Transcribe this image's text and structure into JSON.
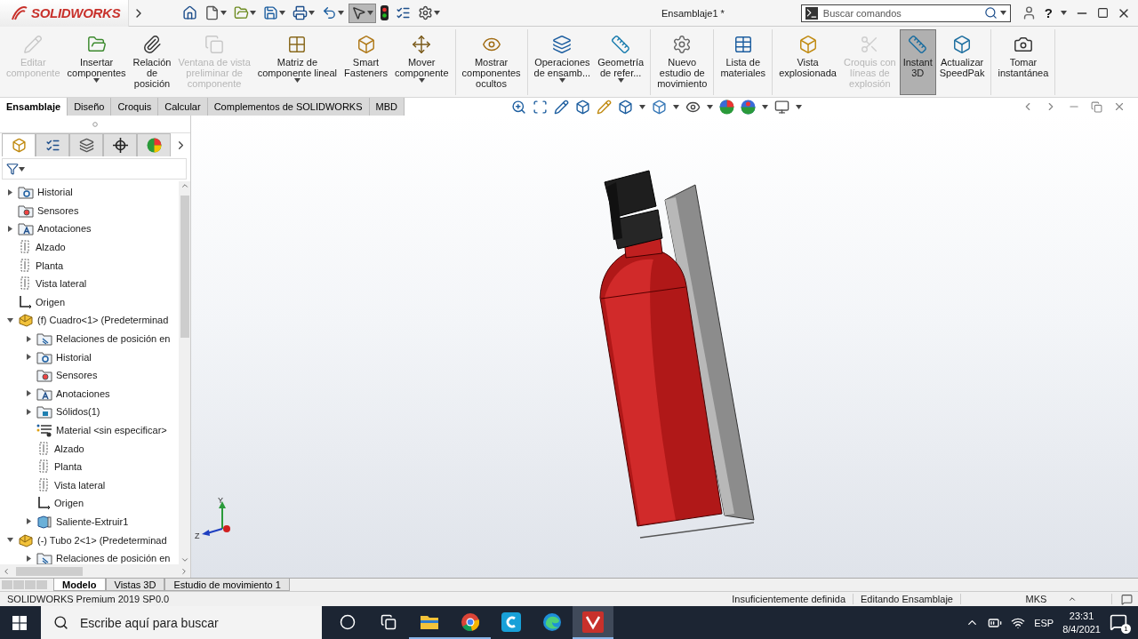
{
  "window": {
    "logo": "SOLIDWORKS",
    "title": "Ensamblaje1 *"
  },
  "quick_toolbar": [
    {
      "kind": "home",
      "dropdown": false,
      "selected": false
    },
    {
      "kind": "new",
      "dropdown": true,
      "selected": false
    },
    {
      "kind": "open",
      "dropdown": true,
      "selected": false
    },
    {
      "kind": "save",
      "dropdown": true,
      "selected": false
    },
    {
      "kind": "print",
      "dropdown": true,
      "selected": false
    },
    {
      "kind": "undo",
      "dropdown": true,
      "selected": false
    },
    {
      "kind": "select",
      "dropdown": true,
      "selected": true
    },
    {
      "kind": "rebuild",
      "dropdown": false,
      "selected": false
    },
    {
      "kind": "file-properties",
      "dropdown": false,
      "selected": false
    },
    {
      "kind": "options",
      "dropdown": true,
      "selected": false
    }
  ],
  "search": {
    "placeholder": "Buscar comandos"
  },
  "help": "?",
  "ribbon": {
    "groups": [
      {
        "items": [
          {
            "label": "Editar\ncomponente",
            "kind": "edit",
            "disabled": true,
            "dropdown": false,
            "selected": false
          },
          {
            "label": "Insertar\ncomponentes",
            "kind": "insert",
            "disabled": false,
            "dropdown": true,
            "selected": false
          },
          {
            "label": "Relación\nde\nposición",
            "kind": "mate",
            "disabled": false,
            "dropdown": false,
            "selected": false
          },
          {
            "label": "Ventana de vista\npreliminar de\ncomponente",
            "kind": "preview",
            "disabled": true,
            "dropdown": false,
            "selected": false
          },
          {
            "label": "Matriz de\ncomponente lineal",
            "kind": "pattern",
            "disabled": false,
            "dropdown": true,
            "selected": false
          },
          {
            "label": "Smart\nFasteners",
            "kind": "fasteners",
            "disabled": false,
            "dropdown": false,
            "selected": false
          },
          {
            "label": "Mover\ncomponente",
            "kind": "move",
            "disabled": false,
            "dropdown": true,
            "selected": false
          }
        ]
      },
      {
        "items": [
          {
            "label": "Mostrar\ncomponentes\nocultos",
            "kind": "show",
            "disabled": false,
            "dropdown": false,
            "selected": false
          }
        ]
      },
      {
        "items": [
          {
            "label": "Operaciones\nde ensamb...",
            "kind": "features",
            "disabled": false,
            "dropdown": true,
            "selected": false
          },
          {
            "label": "Geometría\nde refer...",
            "kind": "reference",
            "disabled": false,
            "dropdown": true,
            "selected": false
          }
        ]
      },
      {
        "items": [
          {
            "label": "Nuevo\nestudio de\nmovimiento",
            "kind": "motion",
            "disabled": false,
            "dropdown": false,
            "selected": false
          }
        ]
      },
      {
        "items": [
          {
            "label": "Lista de\nmateriales",
            "kind": "bom",
            "disabled": false,
            "dropdown": false,
            "selected": false
          }
        ]
      },
      {
        "items": [
          {
            "label": "Vista\nexplosionada",
            "kind": "explode",
            "disabled": false,
            "dropdown": false,
            "selected": false
          },
          {
            "label": "Croquis con\nlíneas de\nexplosión",
            "kind": "explode-sketch",
            "disabled": true,
            "dropdown": false,
            "selected": false
          },
          {
            "label": "Instant\n3D",
            "kind": "instant3d",
            "disabled": false,
            "dropdown": false,
            "selected": true
          },
          {
            "label": "Actualizar\nSpeedPak",
            "kind": "speedpak",
            "disabled": false,
            "dropdown": false,
            "selected": false
          }
        ]
      },
      {
        "items": [
          {
            "label": "Tomar\ninstantánea",
            "kind": "snapshot",
            "disabled": false,
            "dropdown": false,
            "selected": false
          }
        ]
      }
    ]
  },
  "command_tabs": [
    {
      "label": "Ensamblaje",
      "selected": true
    },
    {
      "label": "Diseño",
      "selected": false
    },
    {
      "label": "Croquis",
      "selected": false
    },
    {
      "label": "Calcular",
      "selected": false
    },
    {
      "label": "Complementos de SOLIDWORKS",
      "selected": false
    },
    {
      "label": "MBD",
      "selected": false
    }
  ],
  "feature_tree": {
    "tabs": [
      {
        "kind": "tree",
        "selected": true
      },
      {
        "kind": "property",
        "selected": false
      },
      {
        "kind": "config",
        "selected": false
      },
      {
        "kind": "dimxpert",
        "selected": false
      },
      {
        "kind": "display",
        "selected": false
      }
    ],
    "items": [
      {
        "label": "Historial",
        "kind": "history",
        "expanded": false
      },
      {
        "label": "Sensores",
        "kind": "sensor"
      },
      {
        "label": "Anotaciones",
        "kind": "annotation",
        "expanded": false
      },
      {
        "label": "Alzado",
        "kind": "plane"
      },
      {
        "label": "Planta",
        "kind": "plane"
      },
      {
        "label": "Vista lateral",
        "kind": "plane"
      },
      {
        "label": "Origen",
        "kind": "origin"
      },
      {
        "label": "(f) Cuadro<1> (Predeterminad",
        "kind": "component",
        "expanded": true,
        "children": [
          {
            "label": "Relaciones de posición en",
            "kind": "mates",
            "expanded": false
          },
          {
            "label": "Historial",
            "kind": "history",
            "expanded": false
          },
          {
            "label": "Sensores",
            "kind": "sensor"
          },
          {
            "label": "Anotaciones",
            "kind": "annotation",
            "expanded": false
          },
          {
            "label": "Sólidos(1)",
            "kind": "solids",
            "expanded": false
          },
          {
            "label": "Material <sin especificar>",
            "kind": "material"
          },
          {
            "label": "Alzado",
            "kind": "plane"
          },
          {
            "label": "Planta",
            "kind": "plane"
          },
          {
            "label": "Vista lateral",
            "kind": "plane"
          },
          {
            "label": "Origen",
            "kind": "origin"
          },
          {
            "label": "Saliente-Extruir1",
            "kind": "extrude",
            "expanded": false
          }
        ]
      },
      {
        "label": "(-) Tubo 2<1> (Predeterminad",
        "kind": "component",
        "expanded": true,
        "children": [
          {
            "label": "Relaciones de posición en",
            "kind": "mates",
            "expanded": false
          }
        ]
      }
    ]
  },
  "viewport": {
    "triad": {
      "y_label": "Y",
      "z_label": "Z"
    }
  },
  "model_tabs": [
    {
      "label": "Modelo",
      "selected": true
    },
    {
      "label": "Vistas 3D",
      "selected": false
    },
    {
      "label": "Estudio de movimiento 1",
      "selected": false
    }
  ],
  "status_bar": {
    "product": "SOLIDWORKS Premium 2019 SP0.0",
    "definition": "Insuficientemente definida",
    "mode": "Editando Ensamblaje",
    "units": "MKS"
  },
  "taskbar": {
    "search_placeholder": "Escribe aquí para buscar",
    "apps": [
      {
        "kind": "cortana",
        "running": false,
        "selected": false
      },
      {
        "kind": "task-view",
        "running": false,
        "selected": false
      },
      {
        "kind": "explorer",
        "running": true,
        "selected": false
      },
      {
        "kind": "chrome",
        "running": true,
        "selected": false
      },
      {
        "kind": "c-app",
        "running": false,
        "selected": false
      },
      {
        "kind": "edge",
        "running": false,
        "selected": false
      },
      {
        "kind": "solidworks",
        "running": true,
        "selected": true
      }
    ],
    "language": "ESP",
    "time": "23:31",
    "date": "8/4/2021",
    "notifications": "1"
  }
}
